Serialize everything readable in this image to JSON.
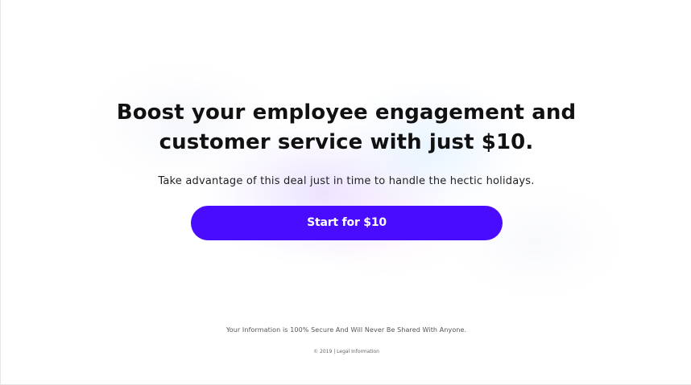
{
  "hero": {
    "headline_line1": "Boost your employee engagement and",
    "headline_line2": "customer service with just $10.",
    "subtitle": "Take advantage of this deal just in time to handle the hectic holidays.",
    "cta_label": "Start for $10"
  },
  "footer": {
    "secure_note": "Your Information is 100% Secure And Will Never Be Shared With Anyone.",
    "copyright": "© 2019",
    "separator": "|",
    "legal_link": "Legal Information"
  },
  "colors": {
    "accent": "#4a0cff",
    "text": "#111111",
    "background": "#ffffff"
  }
}
